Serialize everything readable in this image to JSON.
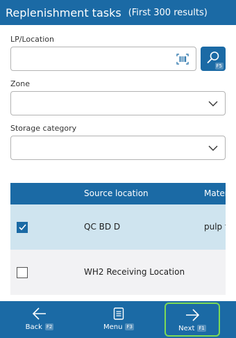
{
  "header": {
    "title": "Replenishment tasks",
    "subtitle": "(First 300 results)"
  },
  "form": {
    "lp_label": "LP/Location",
    "lp_value": "",
    "search_shortcut": "F5",
    "zone_label": "Zone",
    "zone_value": "",
    "storage_label": "Storage category",
    "storage_value": ""
  },
  "grid": {
    "columns": [
      "Source location",
      "Mater"
    ],
    "rows": [
      {
        "checked": true,
        "source": "QC BD D",
        "material": "pulp t"
      },
      {
        "checked": false,
        "source": "WH2 Receiving Location",
        "material": ""
      }
    ]
  },
  "footer": {
    "back_label": "Back",
    "back_key": "F2",
    "menu_label": "Menu",
    "menu_key": "F3",
    "next_label": "Next",
    "next_key": "F1"
  },
  "colors": {
    "accent": "#1b6aa5",
    "selected_row": "#cfe4ef",
    "focus": "#7dd956"
  },
  "icons": [
    "barcode-icon",
    "search-icon",
    "chevron-down-icon",
    "checkmark-icon",
    "arrow-left-icon",
    "menu-icon",
    "arrow-right-icon"
  ]
}
